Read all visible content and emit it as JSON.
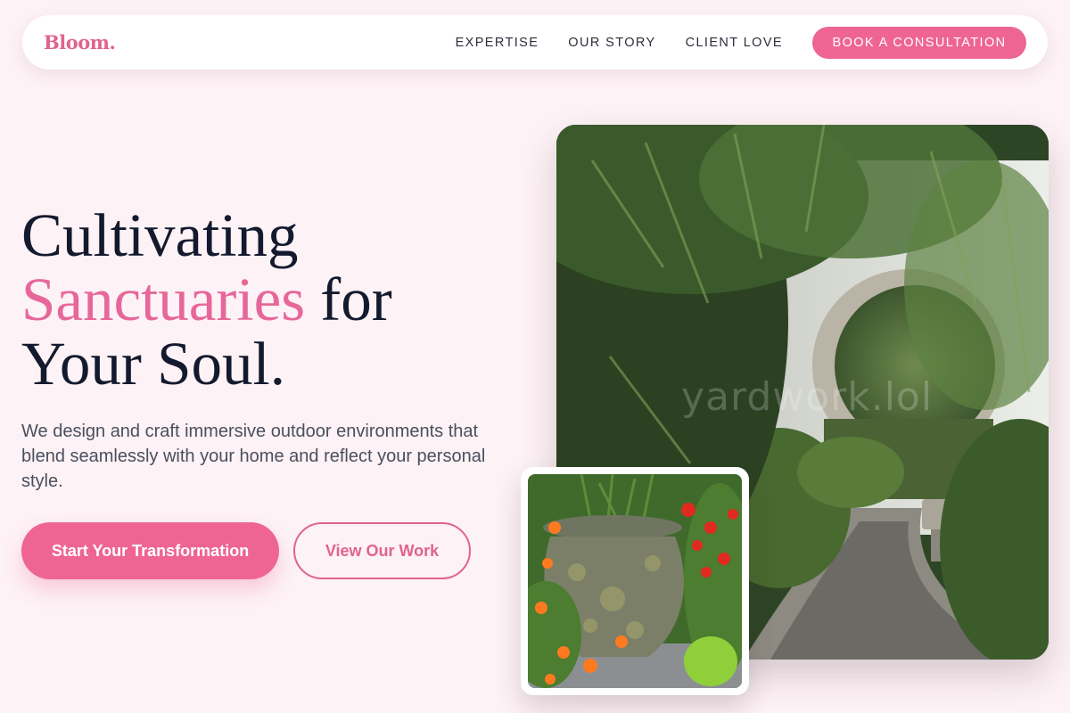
{
  "brand": {
    "logo": "Bloom."
  },
  "nav": {
    "links": [
      "EXPERTISE",
      "OUR STORY",
      "CLIENT LOVE"
    ],
    "cta": "BOOK A CONSULTATION"
  },
  "hero": {
    "title_line1": "Cultivating",
    "title_accent": "Sanctuaries",
    "title_after_accent": " for",
    "title_line3": "Your Soul.",
    "subtitle": "We design and craft immersive outdoor environments that blend seamlessly with your home and reflect your personal style.",
    "primary_button": "Start Your Transformation",
    "secondary_button": "View Our Work"
  },
  "images": {
    "main_watermark": "yardwork.lol",
    "main_subject": "garden path through moon gate archway with bamboo",
    "inset_subject": "stone urn planter with orange marigolds and red zinnias"
  },
  "colors": {
    "background": "#fdf2f5",
    "accent": "#ee6593",
    "heading": "#141a2e",
    "body_text": "#4a4f5e"
  }
}
